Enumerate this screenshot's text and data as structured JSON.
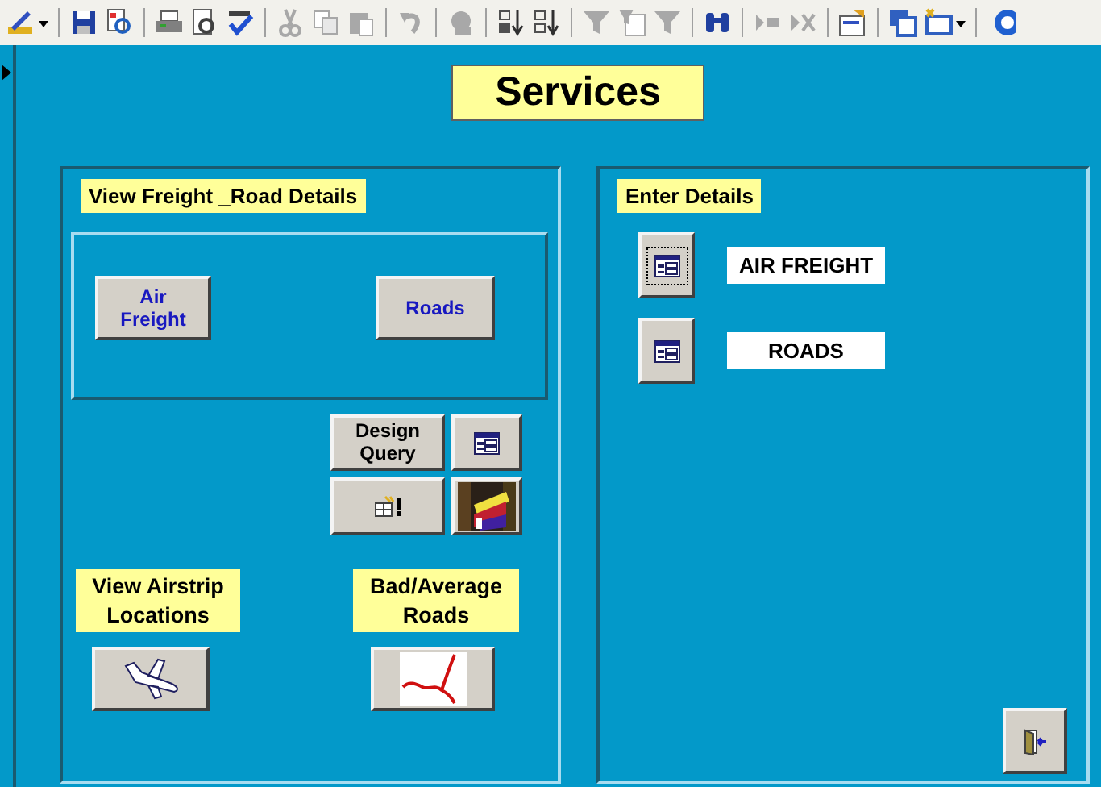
{
  "toolbar": {
    "groups": [
      {
        "items": [
          {
            "kind": "design-view",
            "disabled": false,
            "dropdown": true
          }
        ]
      },
      {
        "items": [
          {
            "kind": "save",
            "disabled": false,
            "dropdown": false
          },
          {
            "kind": "file-search",
            "disabled": false,
            "dropdown": false
          }
        ]
      },
      {
        "items": [
          {
            "kind": "print",
            "disabled": false,
            "dropdown": false
          },
          {
            "kind": "print-preview",
            "disabled": false,
            "dropdown": false
          },
          {
            "kind": "spelling",
            "disabled": false,
            "dropdown": false
          }
        ]
      },
      {
        "items": [
          {
            "kind": "cut",
            "disabled": true,
            "dropdown": false
          },
          {
            "kind": "copy",
            "disabled": true,
            "dropdown": false
          },
          {
            "kind": "paste",
            "disabled": true,
            "dropdown": false
          }
        ]
      },
      {
        "items": [
          {
            "kind": "undo",
            "disabled": true,
            "dropdown": false
          }
        ]
      },
      {
        "items": [
          {
            "kind": "office-links",
            "disabled": true,
            "dropdown": false
          }
        ]
      },
      {
        "items": [
          {
            "kind": "sort-asc",
            "disabled": false,
            "dropdown": false
          },
          {
            "kind": "sort-desc",
            "disabled": false,
            "dropdown": false
          }
        ]
      },
      {
        "items": [
          {
            "kind": "filter-selection",
            "disabled": true,
            "dropdown": false
          },
          {
            "kind": "filter-form",
            "disabled": true,
            "dropdown": false
          },
          {
            "kind": "apply-filter",
            "disabled": true,
            "dropdown": false
          }
        ]
      },
      {
        "items": [
          {
            "kind": "find",
            "disabled": false,
            "dropdown": false
          }
        ]
      },
      {
        "items": [
          {
            "kind": "new-record",
            "disabled": true,
            "dropdown": false
          },
          {
            "kind": "delete-record",
            "disabled": true,
            "dropdown": false
          }
        ]
      },
      {
        "items": [
          {
            "kind": "properties",
            "disabled": false,
            "dropdown": false
          }
        ]
      },
      {
        "items": [
          {
            "kind": "database-window",
            "disabled": false,
            "dropdown": false
          },
          {
            "kind": "new-object",
            "disabled": false,
            "dropdown": true
          }
        ]
      },
      {
        "items": [
          {
            "kind": "help",
            "disabled": false,
            "dropdown": false
          }
        ]
      }
    ]
  },
  "form": {
    "title": "Services"
  },
  "left_panel": {
    "heading": "View Freight _Road Details",
    "view_buttons": [
      {
        "label": "Air Freight"
      },
      {
        "label": "Roads"
      }
    ],
    "design_query_button": {
      "label": "Design Query"
    },
    "captions": [
      {
        "text": "View Airstrip Locations"
      },
      {
        "text": "Bad/Average Roads"
      }
    ]
  },
  "right_panel": {
    "heading": "Enter Details",
    "entries": [
      {
        "value": "AIR FREIGHT",
        "focused": true
      },
      {
        "value": "ROADS",
        "focused": false
      }
    ]
  }
}
